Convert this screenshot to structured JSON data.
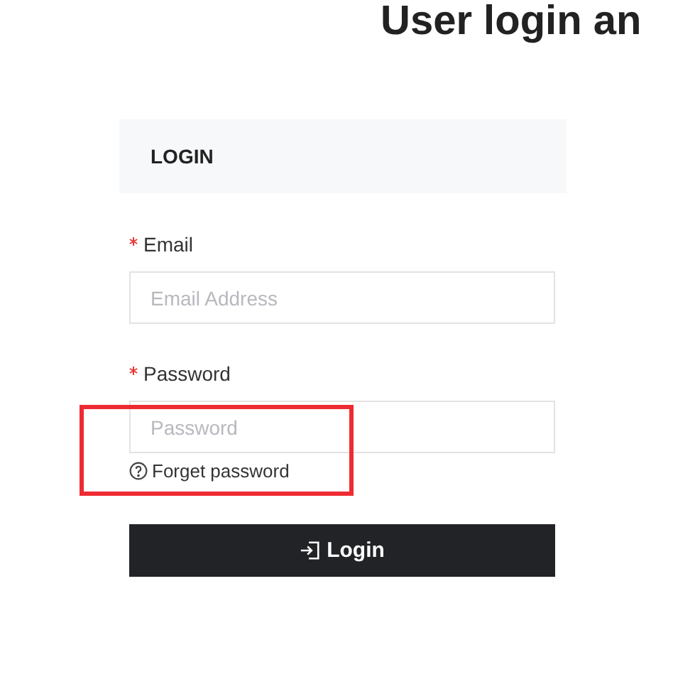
{
  "page_title": "User login an",
  "panel": {
    "title": "LOGIN"
  },
  "fields": [
    {
      "label": "Email",
      "required": true,
      "placeholder": "Email Address"
    },
    {
      "label": "Password",
      "required": true,
      "placeholder": "Password"
    }
  ],
  "forgot_link": "Forget password",
  "login_button": "Login"
}
